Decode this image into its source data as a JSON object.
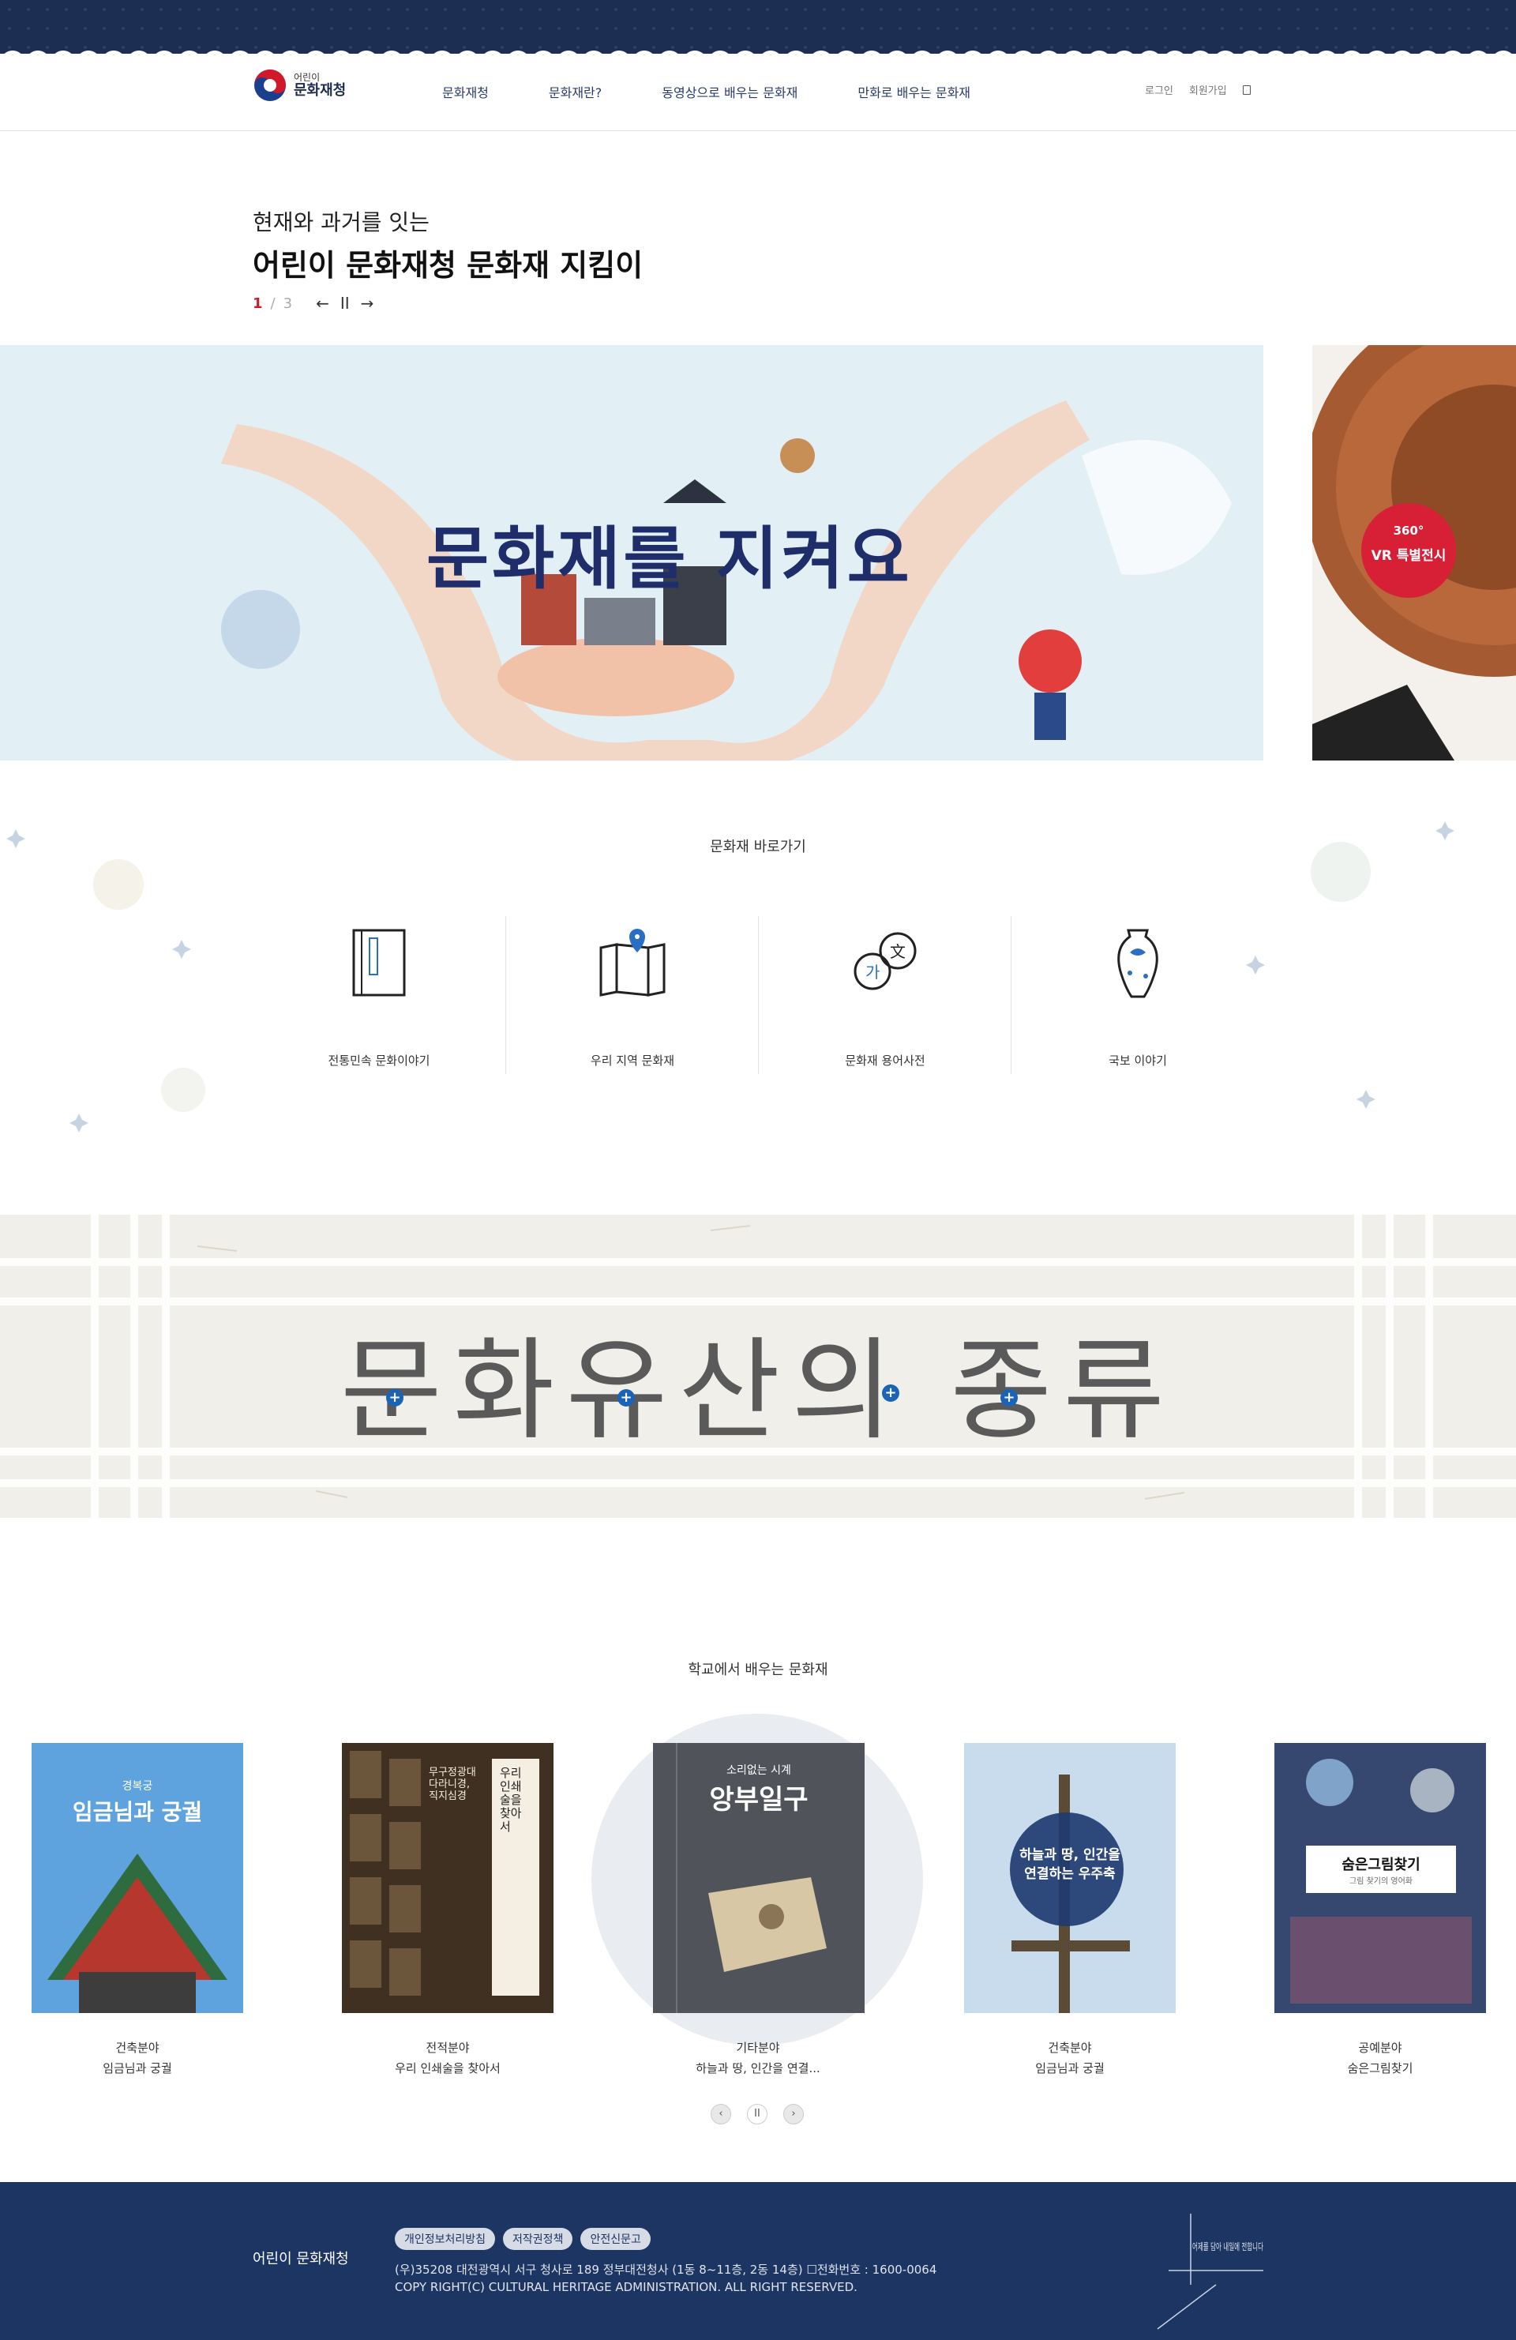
{
  "header": {
    "logo_small": "어린이",
    "logo_big": "문화재청",
    "nav": [
      "문화재청",
      "문화재란?",
      "동영상으로 배우는 문화재",
      "만화로 배우는 문화재"
    ],
    "login": "로그인",
    "signup": "회원가입"
  },
  "hero": {
    "subtitle": "현재와 과거를 잇는",
    "title": "어린이 문화재청 문화재 지킴이",
    "page_current": "1",
    "page_sep": "/",
    "page_total": "3",
    "prev_icon": "←",
    "pause_icon": "II",
    "next_icon": "→",
    "banner_text": "문화재를 지켜요",
    "vr_360": "360°",
    "vr_label": "VR 특별전시"
  },
  "quick": {
    "title": "문화재 바로가기",
    "items": [
      {
        "label": "전통민속 문화이야기",
        "icon": "book-icon"
      },
      {
        "label": "우리 지역 문화재",
        "icon": "map-icon"
      },
      {
        "label": "문화재 용어사전",
        "icon": "dictionary-icon"
      },
      {
        "label": "국보 이야기",
        "icon": "vase-icon"
      }
    ]
  },
  "heritage": {
    "title": "문화유산의 종류",
    "plus": "+"
  },
  "school": {
    "title": "학교에서 배우는 문화재",
    "books": [
      {
        "category": "건축분야",
        "name": "임금님과 궁궐",
        "cover_small": "경복궁",
        "cover_big": "임금님과 궁궐"
      },
      {
        "category": "전적분야",
        "name": "우리 인쇄술을 찾아서",
        "cover_big": "우리 인쇄술을 찾아서",
        "cover_small": "무구정광대다라니경, 직지심경"
      },
      {
        "category": "기타분야",
        "name": "하늘과 땅, 인간을 연결...",
        "cover_small": "소리없는 시계",
        "cover_big": "앙부일구"
      },
      {
        "category": "건축분야",
        "name": "임금님과 궁궐",
        "cover_big": "하늘과 땅, 인간을 연결하는 우주축"
      },
      {
        "category": "공예분야",
        "name": "숨은그림찾기",
        "cover_big": "숨은그림찾기",
        "cover_small": "그림 찾기의 영어화"
      }
    ],
    "prev_icon": "‹",
    "pause_icon": "II",
    "next_icon": "›"
  },
  "footer": {
    "brand": "어린이 문화재청",
    "links": [
      "개인정보처리방침",
      "저작권정책",
      "안전신문고"
    ],
    "address": "(우)35208 대전광역시 서구 청사로 189 정부대전청사 (1동 8~11층, 2동 14층) ☐전화번호 : 1600-0064",
    "copyright": "COPY RIGHT(C) CULTURAL HERITAGE ADMINISTRATION. ALL RIGHT RESERVED.",
    "sign": "어제를 담아 내일에 전합니다"
  },
  "colors": {
    "navy": "#1d3563",
    "accent_red": "#d01a2b",
    "plus_blue": "#1a63b6"
  }
}
